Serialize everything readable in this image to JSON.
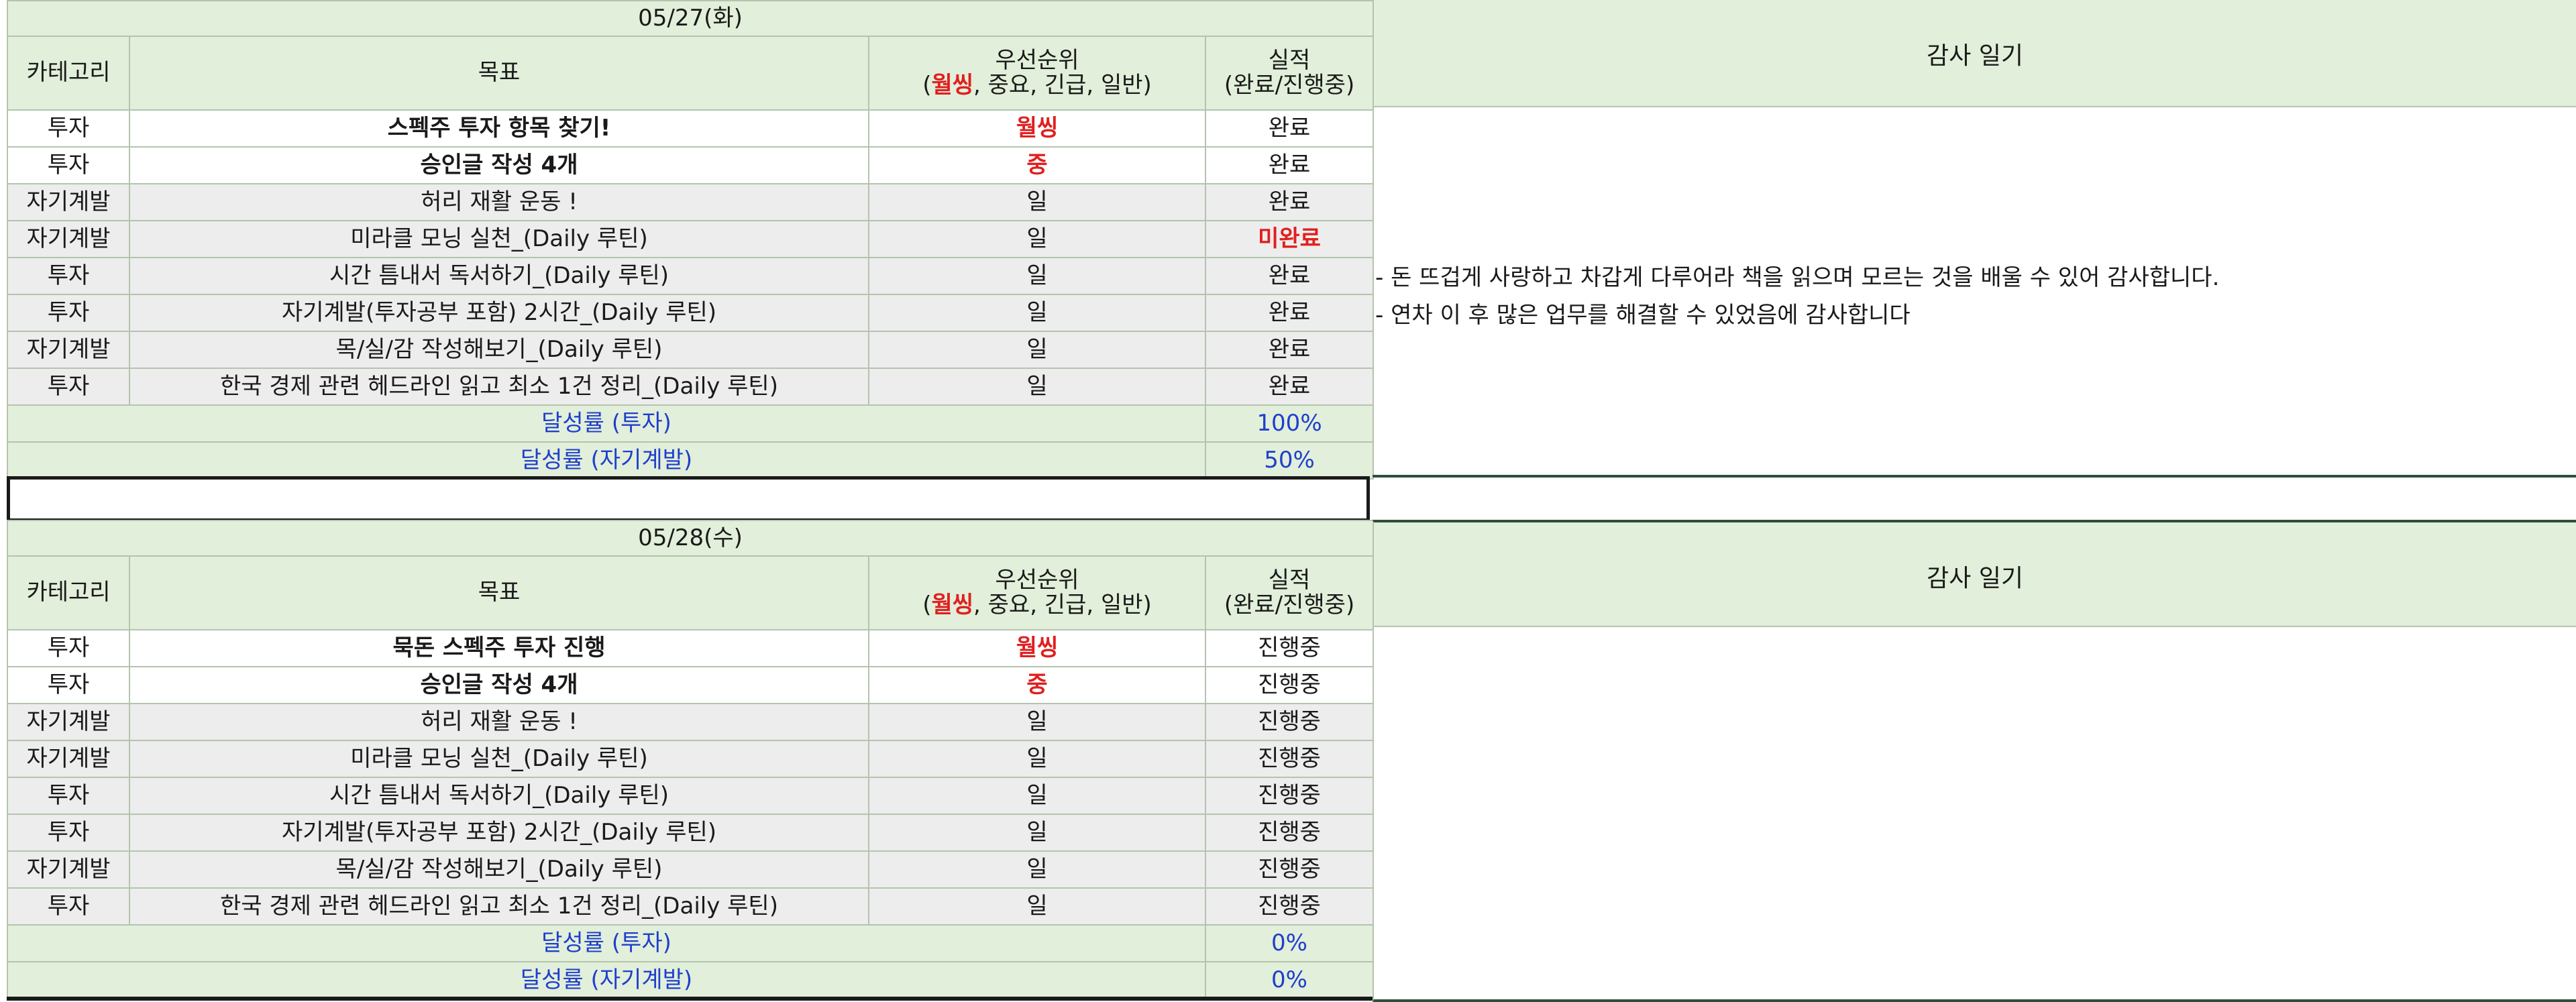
{
  "header_labels": {
    "category": "카테고리",
    "goal": "목표",
    "priority_title": "우선순위",
    "priority_paren_open": "(",
    "priority_top": "월씽",
    "priority_rest": ", 중요, 긴급, 일반)",
    "result_title": "실적",
    "result_sub": "(완료/진행중)",
    "diary_title": "감사 일기"
  },
  "colors": {
    "header_bg": "#e2efda",
    "grey_row_bg": "#ededed",
    "accent_red": "#e02020",
    "summary_blue": "#1f3fcc",
    "border": "#b4c4ae"
  },
  "days": [
    {
      "date": "05/27(화)",
      "rows": [
        {
          "category": "투자",
          "goal": "스펙주 투자 항목 찾기!",
          "priority": "월씽",
          "result": "완료"
        },
        {
          "category": "투자",
          "goal": "승인글 작성 4개",
          "priority": "중",
          "result": "완료"
        },
        {
          "category": "자기계발",
          "goal": "허리 재활 운동 !",
          "priority": "일",
          "result": "완료"
        },
        {
          "category": "자기계발",
          "goal": "미라클 모닝 실천_(Daily 루틴)",
          "priority": "일",
          "result": "미완료"
        },
        {
          "category": "투자",
          "goal": "시간 틈내서 독서하기_(Daily 루틴)",
          "priority": "일",
          "result": "완료"
        },
        {
          "category": "투자",
          "goal": "자기계발(투자공부 포함) 2시간_(Daily 루틴)",
          "priority": "일",
          "result": "완료"
        },
        {
          "category": "자기계발",
          "goal": "목/실/감 작성해보기_(Daily 루틴)",
          "priority": "일",
          "result": "완료"
        },
        {
          "category": "투자",
          "goal": "한국 경제 관련 헤드라인 읽고 최소 1건 정리_(Daily 루틴)",
          "priority": "일",
          "result": "완료"
        }
      ],
      "summary": [
        {
          "label": "달성률 (투자)",
          "value": "100%"
        },
        {
          "label": "달성률 (자기계발)",
          "value": "50%"
        }
      ],
      "diary": [
        "- 돈 뜨겁게 사랑하고 차갑게 다루어라 책을 읽으며 모르는 것을 배울 수 있어 감사합니다.",
        "- 연차 이 후 많은 업무를 해결할 수 있었음에 감사합니다"
      ]
    },
    {
      "date": "05/28(수)",
      "rows": [
        {
          "category": "투자",
          "goal": "묵돈 스펙주 투자 진행",
          "priority": "월씽",
          "result": "진행중"
        },
        {
          "category": "투자",
          "goal": "승인글 작성 4개",
          "priority": "중",
          "result": "진행중"
        },
        {
          "category": "자기계발",
          "goal": "허리 재활 운동 !",
          "priority": "일",
          "result": "진행중"
        },
        {
          "category": "자기계발",
          "goal": "미라클 모닝 실천_(Daily 루틴)",
          "priority": "일",
          "result": "진행중"
        },
        {
          "category": "투자",
          "goal": "시간 틈내서 독서하기_(Daily 루틴)",
          "priority": "일",
          "result": "진행중"
        },
        {
          "category": "투자",
          "goal": "자기계발(투자공부 포함) 2시간_(Daily 루틴)",
          "priority": "일",
          "result": "진행중"
        },
        {
          "category": "자기계발",
          "goal": "목/실/감 작성해보기_(Daily 루틴)",
          "priority": "일",
          "result": "진행중"
        },
        {
          "category": "투자",
          "goal": "한국 경제 관련 헤드라인 읽고 최소 1건 정리_(Daily 루틴)",
          "priority": "일",
          "result": "진행중"
        }
      ],
      "summary": [
        {
          "label": "달성률 (투자)",
          "value": "0%"
        },
        {
          "label": "달성률 (자기계발)",
          "value": "0%"
        }
      ],
      "diary": []
    }
  ]
}
